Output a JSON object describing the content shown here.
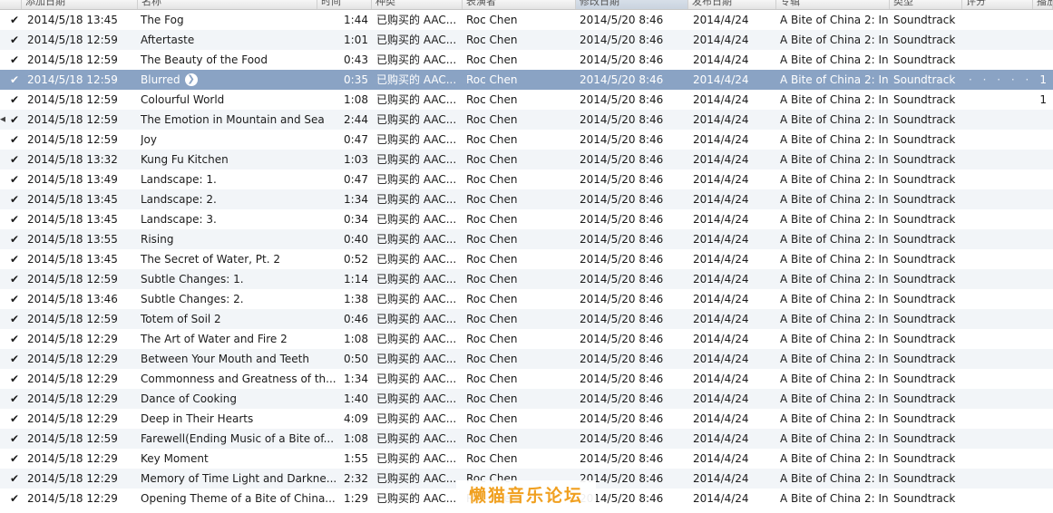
{
  "columns": {
    "added": "添加日期",
    "name": "名称",
    "time": "时间",
    "kind": "种类",
    "artist": "表演者",
    "modified": "修改日期",
    "release": "发布日期",
    "album": "专辑",
    "genre": "类型",
    "plays": "评分",
    "count": "播放"
  },
  "watermark": "懒猫音乐论坛",
  "rows": [
    {
      "check": "✔",
      "added": "2014/5/18 13:45",
      "name": "The Fog",
      "time": "1:44",
      "kind": "已购买的 AAC...",
      "artist": "Roc Chen",
      "modified": "2014/5/20 8:46",
      "release": "2014/4/24",
      "album": "A Bite of China 2: In...",
      "genre": "Soundtrack",
      "rating": "",
      "count": ""
    },
    {
      "check": "✔",
      "added": "2014/5/18 12:59",
      "name": "Aftertaste",
      "time": "1:01",
      "kind": "已购买的 AAC...",
      "artist": "Roc Chen",
      "modified": "2014/5/20 8:46",
      "release": "2014/4/24",
      "album": "A Bite of China 2: In...",
      "genre": "Soundtrack",
      "rating": "",
      "count": ""
    },
    {
      "check": "✔",
      "added": "2014/5/18 12:59",
      "name": "The Beauty of the Food",
      "time": "0:43",
      "kind": "已购买的 AAC...",
      "artist": "Roc Chen",
      "modified": "2014/5/20 8:46",
      "release": "2014/4/24",
      "album": "A Bite of China 2: In...",
      "genre": "Soundtrack",
      "rating": "",
      "count": ""
    },
    {
      "check": "✔",
      "added": "2014/5/18 12:59",
      "name": "Blurred",
      "time": "0:35",
      "kind": "已购买的 AAC...",
      "artist": "Roc Chen",
      "modified": "2014/5/20 8:46",
      "release": "2014/4/24",
      "album": "A Bite of China 2: In...",
      "genre": "Soundtrack",
      "rating": "· · · · ·",
      "count": "1"
    },
    {
      "check": "✔",
      "added": "2014/5/18 12:59",
      "name": "Colourful World",
      "time": "1:08",
      "kind": "已购买的 AAC...",
      "artist": "Roc Chen",
      "modified": "2014/5/20 8:46",
      "release": "2014/4/24",
      "album": "A Bite of China 2: In...",
      "genre": "Soundtrack",
      "rating": "",
      "count": "1"
    },
    {
      "check": "✔",
      "added": "2014/5/18 12:59",
      "name": "The Emotion in Mountain and Sea",
      "time": "2:44",
      "kind": "已购买的 AAC...",
      "artist": "Roc Chen",
      "modified": "2014/5/20 8:46",
      "release": "2014/4/24",
      "album": "A Bite of China 2: In...",
      "genre": "Soundtrack",
      "rating": "",
      "count": ""
    },
    {
      "check": "✔",
      "added": "2014/5/18 12:59",
      "name": "Joy",
      "time": "0:47",
      "kind": "已购买的 AAC...",
      "artist": "Roc Chen",
      "modified": "2014/5/20 8:46",
      "release": "2014/4/24",
      "album": "A Bite of China 2: In...",
      "genre": "Soundtrack",
      "rating": "",
      "count": ""
    },
    {
      "check": "✔",
      "added": "2014/5/18 13:32",
      "name": "Kung Fu Kitchen",
      "time": "1:03",
      "kind": "已购买的 AAC...",
      "artist": "Roc Chen",
      "modified": "2014/5/20 8:46",
      "release": "2014/4/24",
      "album": "A Bite of China 2: In...",
      "genre": "Soundtrack",
      "rating": "",
      "count": ""
    },
    {
      "check": "✔",
      "added": "2014/5/18 13:49",
      "name": "Landscape: 1.",
      "time": "0:47",
      "kind": "已购买的 AAC...",
      "artist": "Roc Chen",
      "modified": "2014/5/20 8:46",
      "release": "2014/4/24",
      "album": "A Bite of China 2: In...",
      "genre": "Soundtrack",
      "rating": "",
      "count": ""
    },
    {
      "check": "✔",
      "added": "2014/5/18 13:45",
      "name": "Landscape: 2.",
      "time": "1:34",
      "kind": "已购买的 AAC...",
      "artist": "Roc Chen",
      "modified": "2014/5/20 8:46",
      "release": "2014/4/24",
      "album": "A Bite of China 2: In...",
      "genre": "Soundtrack",
      "rating": "",
      "count": ""
    },
    {
      "check": "✔",
      "added": "2014/5/18 13:45",
      "name": "Landscape: 3.",
      "time": "0:34",
      "kind": "已购买的 AAC...",
      "artist": "Roc Chen",
      "modified": "2014/5/20 8:46",
      "release": "2014/4/24",
      "album": "A Bite of China 2: In...",
      "genre": "Soundtrack",
      "rating": "",
      "count": ""
    },
    {
      "check": "✔",
      "added": "2014/5/18 13:55",
      "name": "Rising",
      "time": "0:40",
      "kind": "已购买的 AAC...",
      "artist": "Roc Chen",
      "modified": "2014/5/20 8:46",
      "release": "2014/4/24",
      "album": "A Bite of China 2: In...",
      "genre": "Soundtrack",
      "rating": "",
      "count": ""
    },
    {
      "check": "✔",
      "added": "2014/5/18 13:45",
      "name": "The Secret of Water, Pt. 2",
      "time": "0:52",
      "kind": "已购买的 AAC...",
      "artist": "Roc Chen",
      "modified": "2014/5/20 8:46",
      "release": "2014/4/24",
      "album": "A Bite of China 2: In...",
      "genre": "Soundtrack",
      "rating": "",
      "count": ""
    },
    {
      "check": "✔",
      "added": "2014/5/18 12:59",
      "name": "Subtle Changes: 1.",
      "time": "1:14",
      "kind": "已购买的 AAC...",
      "artist": "Roc Chen",
      "modified": "2014/5/20 8:46",
      "release": "2014/4/24",
      "album": "A Bite of China 2: In...",
      "genre": "Soundtrack",
      "rating": "",
      "count": ""
    },
    {
      "check": "✔",
      "added": "2014/5/18 13:46",
      "name": "Subtle Changes: 2.",
      "time": "1:38",
      "kind": "已购买的 AAC...",
      "artist": "Roc Chen",
      "modified": "2014/5/20 8:46",
      "release": "2014/4/24",
      "album": "A Bite of China 2: In...",
      "genre": "Soundtrack",
      "rating": "",
      "count": ""
    },
    {
      "check": "✔",
      "added": "2014/5/18 12:59",
      "name": "Totem of Soil 2",
      "time": "0:46",
      "kind": "已购买的 AAC...",
      "artist": "Roc Chen",
      "modified": "2014/5/20 8:46",
      "release": "2014/4/24",
      "album": "A Bite of China 2: In...",
      "genre": "Soundtrack",
      "rating": "",
      "count": ""
    },
    {
      "check": "✔",
      "added": "2014/5/18 12:29",
      "name": "The Art of Water and Fire 2",
      "time": "1:08",
      "kind": "已购买的 AAC...",
      "artist": "Roc Chen",
      "modified": "2014/5/20 8:46",
      "release": "2014/4/24",
      "album": "A Bite of China 2: In...",
      "genre": "Soundtrack",
      "rating": "",
      "count": ""
    },
    {
      "check": "✔",
      "added": "2014/5/18 12:29",
      "name": "Between Your Mouth and Teeth",
      "time": "0:50",
      "kind": "已购买的 AAC...",
      "artist": "Roc Chen",
      "modified": "2014/5/20 8:46",
      "release": "2014/4/24",
      "album": "A Bite of China 2: In...",
      "genre": "Soundtrack",
      "rating": "",
      "count": ""
    },
    {
      "check": "✔",
      "added": "2014/5/18 12:29",
      "name": "Commonness and Greatness of th...",
      "time": "1:34",
      "kind": "已购买的 AAC...",
      "artist": "Roc Chen",
      "modified": "2014/5/20 8:46",
      "release": "2014/4/24",
      "album": "A Bite of China 2: In...",
      "genre": "Soundtrack",
      "rating": "",
      "count": ""
    },
    {
      "check": "✔",
      "added": "2014/5/18 12:29",
      "name": "Dance of Cooking",
      "time": "1:40",
      "kind": "已购买的 AAC...",
      "artist": "Roc Chen",
      "modified": "2014/5/20 8:46",
      "release": "2014/4/24",
      "album": "A Bite of China 2: In...",
      "genre": "Soundtrack",
      "rating": "",
      "count": ""
    },
    {
      "check": "✔",
      "added": "2014/5/18 12:29",
      "name": "Deep in Their Hearts",
      "time": "4:09",
      "kind": "已购买的 AAC...",
      "artist": "Roc Chen",
      "modified": "2014/5/20 8:46",
      "release": "2014/4/24",
      "album": "A Bite of China 2: In...",
      "genre": "Soundtrack",
      "rating": "",
      "count": ""
    },
    {
      "check": "✔",
      "added": "2014/5/18 12:59",
      "name": "Farewell(Ending Music of a Bite of...",
      "time": "1:08",
      "kind": "已购买的 AAC...",
      "artist": "Roc Chen",
      "modified": "2014/5/20 8:46",
      "release": "2014/4/24",
      "album": "A Bite of China 2: In...",
      "genre": "Soundtrack",
      "rating": "",
      "count": ""
    },
    {
      "check": "✔",
      "added": "2014/5/18 12:29",
      "name": "Key Moment",
      "time": "1:55",
      "kind": "已购买的 AAC...",
      "artist": "Roc Chen",
      "modified": "2014/5/20 8:46",
      "release": "2014/4/24",
      "album": "A Bite of China 2: In...",
      "genre": "Soundtrack",
      "rating": "",
      "count": ""
    },
    {
      "check": "✔",
      "added": "2014/5/18 12:29",
      "name": "Memory of Time Light and Darkne...",
      "time": "2:32",
      "kind": "已购买的 AAC...",
      "artist": "Roc Chen",
      "modified": "2014/5/20 8:46",
      "release": "2014/4/24",
      "album": "A Bite of China 2: In...",
      "genre": "Soundtrack",
      "rating": "",
      "count": ""
    },
    {
      "check": "✔",
      "added": "2014/5/18 12:29",
      "name": "Opening Theme of a Bite of China...",
      "time": "1:29",
      "kind": "已购买的 AAC...",
      "artist": "Roc Chen",
      "modified": "2014/5/20 8:46",
      "release": "2014/4/24",
      "album": "A Bite of China 2: In...",
      "genre": "Soundtrack",
      "rating": "",
      "count": ""
    }
  ]
}
